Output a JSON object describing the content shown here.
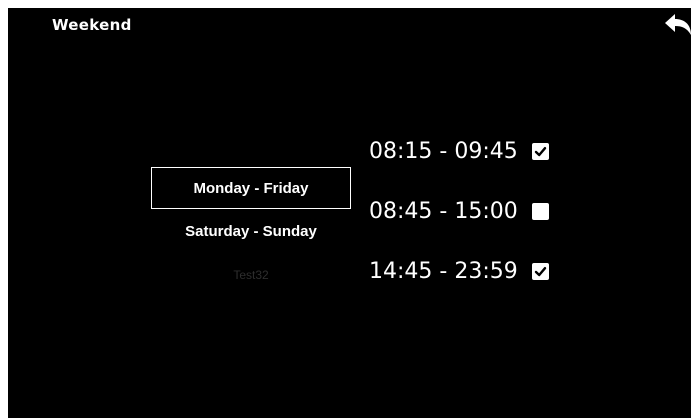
{
  "header": {
    "title": "Weekend",
    "back_icon": "back-arrow-icon"
  },
  "day_options": [
    {
      "label": "Monday - Friday",
      "selected": true
    },
    {
      "label": "Saturday - Sunday",
      "selected": false
    },
    {
      "label": "Test32",
      "selected": false
    }
  ],
  "time_slots": [
    {
      "time": "08:15 - 09:45",
      "checked": true
    },
    {
      "time": "08:45 - 15:00",
      "checked": false
    },
    {
      "time": "14:45 - 23:59",
      "checked": true
    }
  ],
  "colors": {
    "background": "#000000",
    "foreground": "#ffffff",
    "dimmed_text": "#2e2e2e"
  }
}
